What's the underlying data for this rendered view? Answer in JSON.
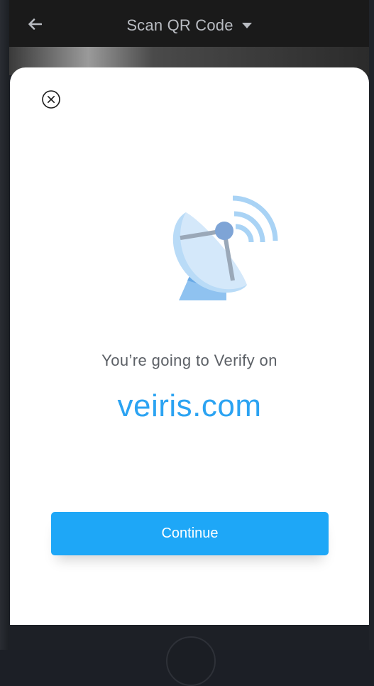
{
  "header": {
    "title": "Scan QR Code",
    "back_icon": "arrow-left-icon",
    "dropdown_icon": "caret-down-icon"
  },
  "sheet": {
    "close_icon": "close-circle-icon",
    "illustration_icon": "satellite-dish-icon",
    "message": "You’re going to Verify on",
    "domain": "veiris.com",
    "continue_label": "Continue"
  },
  "colors": {
    "accent": "#1ea7f7",
    "domain": "#2ba3f2",
    "header_bg": "#1a1a1a",
    "sheet_bg": "#ffffff"
  }
}
